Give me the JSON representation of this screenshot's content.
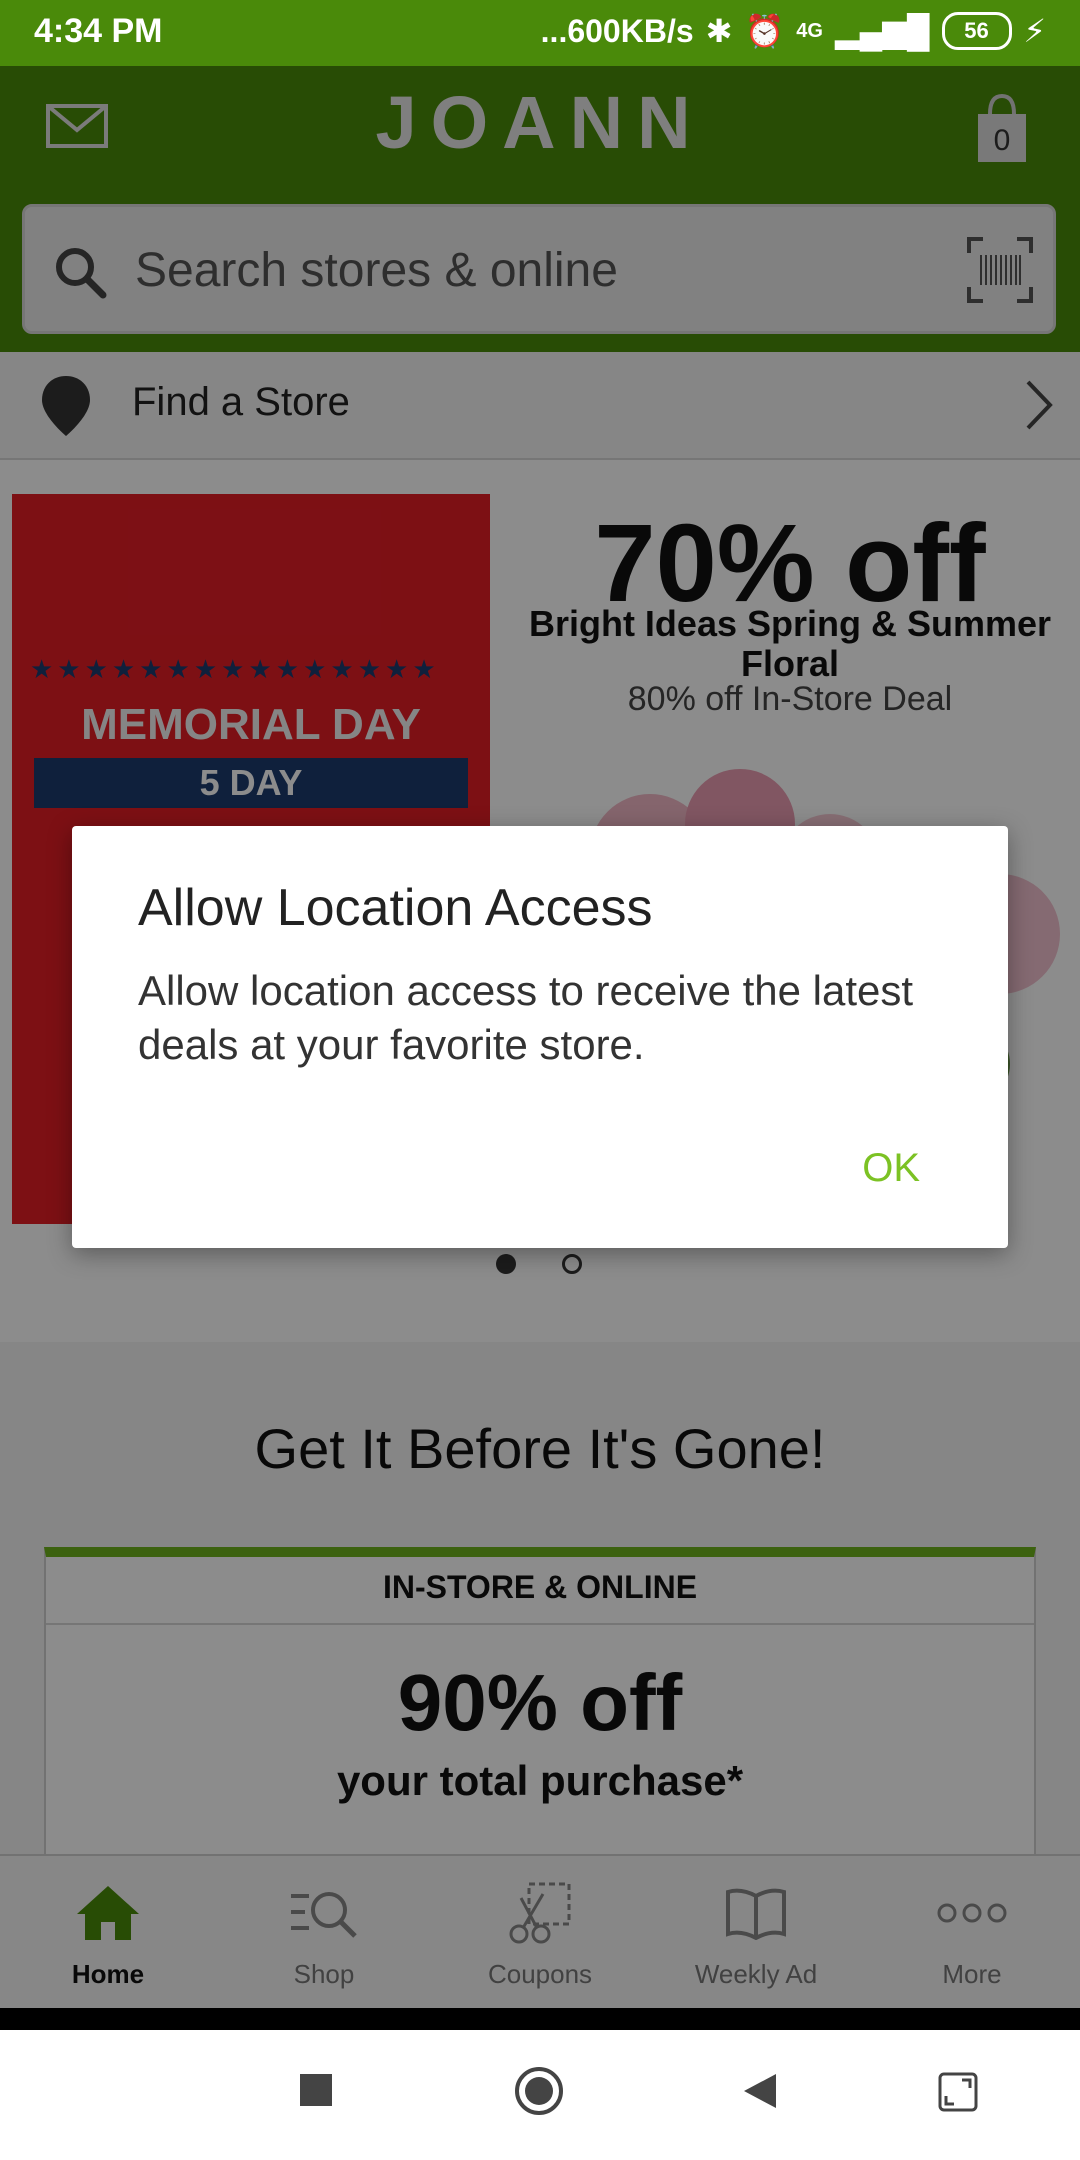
{
  "status_bar": {
    "time": "4:34 PM",
    "speed": "...600KB/s",
    "network": "4G",
    "battery": "56"
  },
  "header": {
    "logo": "JOANN",
    "cart_count": "0",
    "search_placeholder": "Search stores & online"
  },
  "find_store": {
    "label": "Find a Store"
  },
  "banner": {
    "left": {
      "headline": "MEMORIAL DAY",
      "subline": "5 DAY"
    },
    "right": {
      "headline": "70% off",
      "subtitle": "Bright Ideas Spring & Summer Floral",
      "deal": "80% off In-Store Deal"
    }
  },
  "section": {
    "title": "Get It Before It's Gone!",
    "card": {
      "label": "IN-STORE & ONLINE",
      "value": "90% off",
      "description": "your total purchase*"
    }
  },
  "bottom_nav": {
    "items": [
      {
        "label": "Home",
        "icon": "home-icon",
        "active": true
      },
      {
        "label": "Shop",
        "icon": "shop-search-icon",
        "active": false
      },
      {
        "label": "Coupons",
        "icon": "scissors-coupon-icon",
        "active": false
      },
      {
        "label": "Weekly Ad",
        "icon": "book-icon",
        "active": false
      },
      {
        "label": "More",
        "icon": "more-dots-icon",
        "active": false
      }
    ]
  },
  "dialog": {
    "title": "Allow Location Access",
    "message": "Allow location access to receive the latest deals at your favorite store.",
    "ok_label": "OK"
  },
  "colors": {
    "brand_green": "#4a8a0a",
    "accent_green": "#7cc224",
    "banner_red": "#e41e26",
    "navy": "#1d3b6e"
  }
}
